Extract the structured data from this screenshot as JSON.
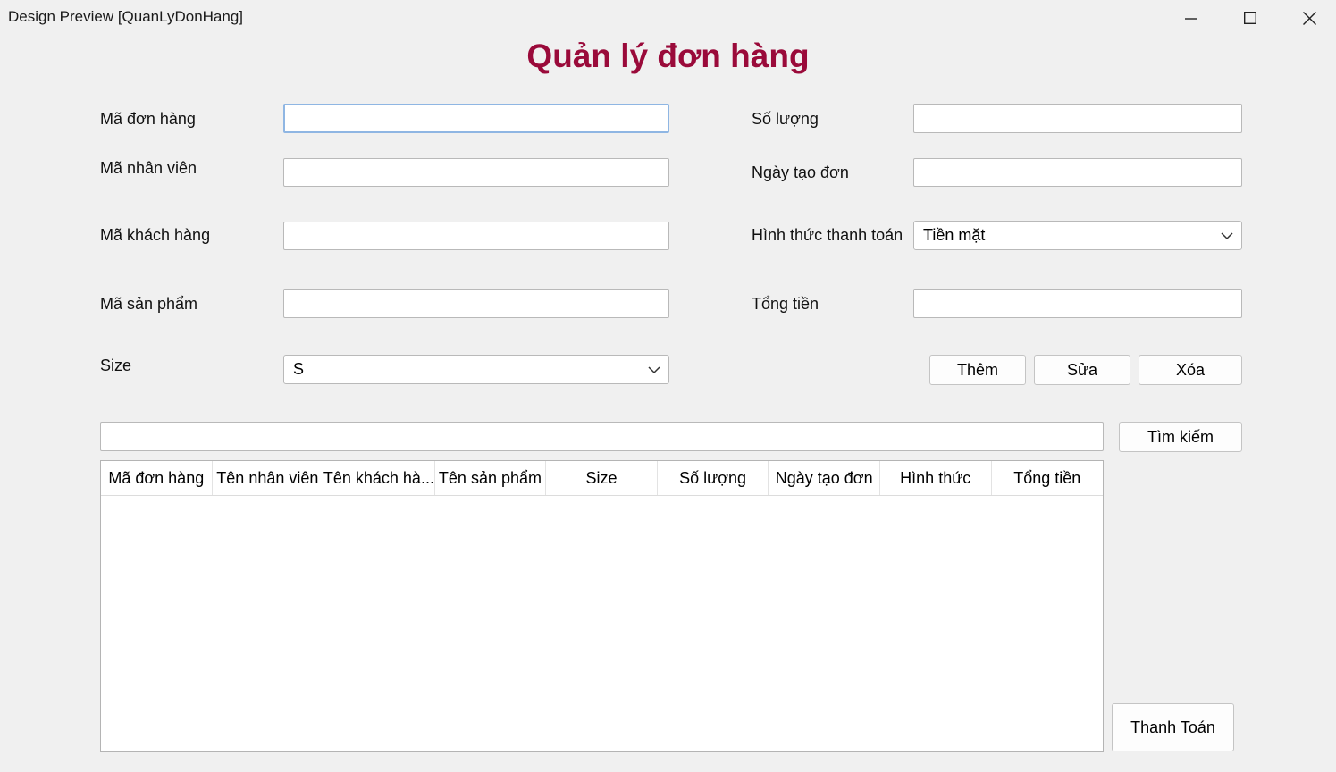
{
  "window": {
    "title": "Design Preview [QuanLyDonHang]"
  },
  "form": {
    "title": "Quản lý đơn hàng"
  },
  "fields": {
    "ma_don_hang": {
      "label": "Mã đơn hàng",
      "value": ""
    },
    "ma_nhan_vien": {
      "label": "Mã nhân viên",
      "value": ""
    },
    "ma_khach_hang": {
      "label": "Mã khách hàng",
      "value": ""
    },
    "ma_san_pham": {
      "label": "Mã sản phẩm",
      "value": ""
    },
    "size": {
      "label": "Size",
      "selected": "S"
    },
    "so_luong": {
      "label": "Số lượng",
      "value": ""
    },
    "ngay_tao_don": {
      "label": "Ngày tạo đơn",
      "value": ""
    },
    "hinh_thuc": {
      "label": "Hình thức thanh toán",
      "selected": "Tiền mặt"
    },
    "tong_tien": {
      "label": "Tổng tiền",
      "value": ""
    }
  },
  "buttons": {
    "them": "Thêm",
    "sua": "Sửa",
    "xoa": "Xóa",
    "tim_kiem": "Tìm kiếm",
    "thanh_toan": "Thanh Toán"
  },
  "search": {
    "value": ""
  },
  "grid": {
    "columns": [
      "Mã đơn hàng",
      "Tên nhân viên",
      "Tên khách hà...",
      "Tên sản phẩm",
      "Size",
      "Số lượng",
      "Ngày tạo đơn",
      "Hình thức",
      "Tổng tiền"
    ],
    "rows": []
  },
  "icons": {
    "minimize": "minimize-icon",
    "maximize": "maximize-icon",
    "close": "close-icon",
    "dropdown": "chevron-down-icon"
  },
  "colors": {
    "title": "#9a0a3a",
    "background": "#f0f0f0",
    "focus_border": "#8fb6e3"
  }
}
